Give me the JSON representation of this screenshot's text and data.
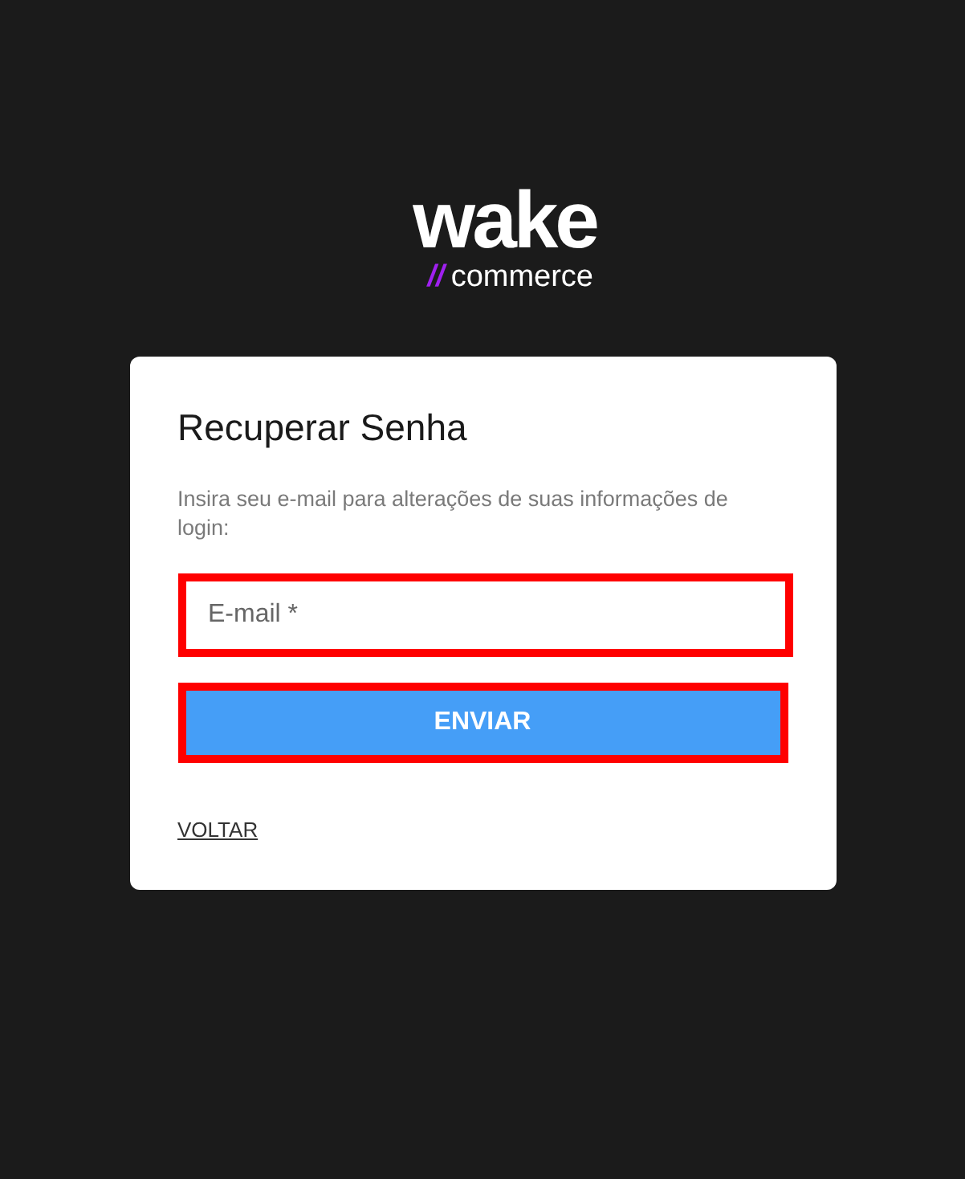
{
  "logo": {
    "wordmark": "wake",
    "slashes": "//",
    "tagline": "commerce"
  },
  "card": {
    "title": "Recuperar Senha",
    "description": "Insira seu e-mail para alterações de suas informações de login:",
    "email_field": {
      "placeholder": "E-mail *"
    },
    "submit_button": "ENVIAR",
    "back_link": "VOLTAR"
  }
}
